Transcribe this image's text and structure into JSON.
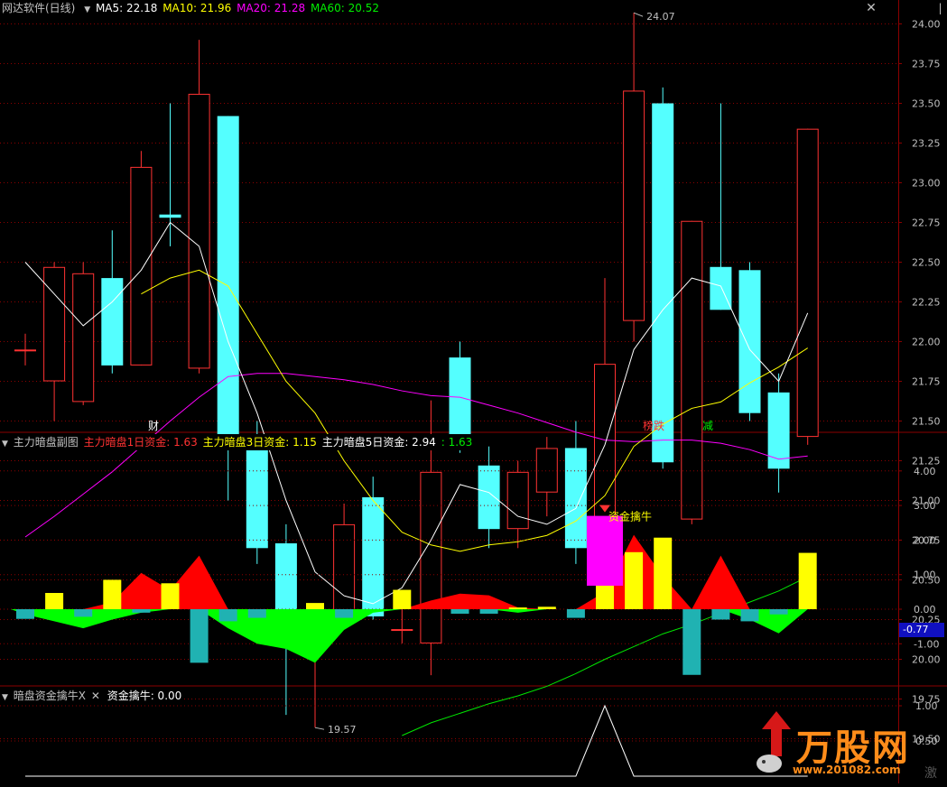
{
  "header": {
    "title": "网达软件(日线)",
    "ma5_label": "MA5: 22.18",
    "ma10_label": "MA10: 21.96",
    "ma20_label": "MA20: 21.28",
    "ma60_label": "MA60: 20.52"
  },
  "colors": {
    "up": "#ff3232",
    "down": "#54ffff",
    "ma5": "#ffffff",
    "ma10": "#ffff00",
    "ma20": "#ff00ff",
    "ma60": "#00e600",
    "grid": "#8b0000",
    "axis_text": "#c0c0c0"
  },
  "main_chart": {
    "y_ticks": [
      "24.00",
      "23.75",
      "23.50",
      "23.25",
      "23.00",
      "22.75",
      "22.50",
      "22.25",
      "22.00",
      "21.75",
      "21.50",
      "21.25",
      "21.00",
      "20.75",
      "20.50",
      "20.25",
      "20.00",
      "19.75",
      "19.50"
    ],
    "high_label": "24.07",
    "low_label": "19.57",
    "events": [
      "财",
      "榜跌",
      "减"
    ],
    "candles": [
      {
        "o": 21.95,
        "c": 21.95,
        "h": 22.05,
        "l": 21.85
      },
      {
        "o": 21.75,
        "c": 22.47,
        "h": 22.5,
        "l": 21.5
      },
      {
        "o": 21.62,
        "c": 22.43,
        "h": 22.5,
        "l": 21.6
      },
      {
        "o": 22.4,
        "c": 21.85,
        "h": 22.7,
        "l": 21.8
      },
      {
        "o": 21.85,
        "c": 23.1,
        "h": 23.2,
        "l": 21.85
      },
      {
        "o": 22.8,
        "c": 22.78,
        "h": 23.5,
        "l": 22.6
      },
      {
        "o": 21.83,
        "c": 23.56,
        "h": 23.9,
        "l": 21.8
      },
      {
        "o": 23.42,
        "c": 21.35,
        "h": 23.42,
        "l": 21.0
      },
      {
        "o": 21.35,
        "c": 20.7,
        "h": 21.5,
        "l": 20.6
      },
      {
        "o": 20.73,
        "c": 20.25,
        "h": 20.85,
        "l": 19.65
      },
      {
        "o": 20.22,
        "c": 20.3,
        "h": 20.3,
        "l": 19.57
      },
      {
        "o": 20.3,
        "c": 20.85,
        "h": 20.98,
        "l": 20.22
      },
      {
        "o": 21.02,
        "c": 20.27,
        "h": 21.15,
        "l": 20.25
      },
      {
        "o": 20.19,
        "c": 20.19,
        "h": 20.38,
        "l": 20.1
      },
      {
        "o": 20.1,
        "c": 21.18,
        "h": 21.63,
        "l": 19.9
      },
      {
        "o": 21.9,
        "c": 21.33,
        "h": 22.0,
        "l": 21.3
      },
      {
        "o": 21.22,
        "c": 20.82,
        "h": 21.34,
        "l": 20.7
      },
      {
        "o": 20.82,
        "c": 21.18,
        "h": 21.25,
        "l": 20.7
      },
      {
        "o": 21.05,
        "c": 21.33,
        "h": 21.4,
        "l": 20.9
      },
      {
        "o": 21.33,
        "c": 20.7,
        "h": 21.5,
        "l": 20.6
      },
      {
        "o": 20.78,
        "c": 21.86,
        "h": 22.4,
        "l": 20.68
      },
      {
        "o": 22.13,
        "c": 23.58,
        "h": 24.07,
        "l": 22.0
      },
      {
        "o": 23.5,
        "c": 21.24,
        "h": 23.6,
        "l": 21.2
      },
      {
        "o": 20.88,
        "c": 22.76,
        "h": 22.76,
        "l": 20.85
      },
      {
        "o": 22.47,
        "c": 22.2,
        "h": 23.5,
        "l": 22.2
      },
      {
        "o": 22.45,
        "c": 21.55,
        "h": 22.5,
        "l": 21.5
      },
      {
        "o": 21.68,
        "c": 21.2,
        "h": 21.8,
        "l": 21.05
      },
      {
        "o": 21.4,
        "c": 23.34,
        "h": 23.34,
        "l": 21.35
      }
    ],
    "ma5": [
      22.5,
      22.3,
      22.1,
      22.25,
      22.45,
      22.75,
      22.6,
      22.0,
      21.55,
      21.0,
      20.55,
      20.4,
      20.35,
      20.45,
      20.75,
      21.1,
      21.05,
      20.9,
      20.85,
      20.95,
      21.35,
      21.95,
      22.2,
      22.4,
      22.35,
      21.95,
      21.75,
      22.18
    ],
    "ma10": [
      null,
      null,
      null,
      null,
      22.3,
      22.4,
      22.45,
      22.35,
      22.05,
      21.75,
      21.55,
      21.25,
      21.0,
      20.8,
      20.72,
      20.68,
      20.72,
      20.74,
      20.78,
      20.87,
      21.03,
      21.34,
      21.48,
      21.58,
      21.62,
      21.74,
      21.84,
      21.96
    ],
    "ma20": [
      20.77,
      20.9,
      21.04,
      21.18,
      21.34,
      21.5,
      21.65,
      21.78,
      21.8,
      21.8,
      21.78,
      21.76,
      21.73,
      21.69,
      21.66,
      21.65,
      21.6,
      21.55,
      21.49,
      21.43,
      21.38,
      21.37,
      21.38,
      21.38,
      21.36,
      21.32,
      21.26,
      21.28
    ],
    "ma60": [
      null,
      null,
      null,
      null,
      null,
      null,
      null,
      null,
      null,
      null,
      null,
      null,
      null,
      19.52,
      19.6,
      19.66,
      19.72,
      19.77,
      19.83,
      19.91,
      20.0,
      20.08,
      20.16,
      20.22,
      20.29,
      20.36,
      20.43,
      20.52
    ]
  },
  "sub_chart": {
    "title": "主力暗盘副图",
    "label1": "主力暗盘1日资金: 1.63",
    "label3": "主力暗盘3日资金: 1.15",
    "label5": "主力暗盘5日资金: 2.94",
    "label_extra": ": 1.63",
    "y_ticks": [
      "4.00",
      "3.00",
      "2.00",
      "1.00",
      "0.00",
      "-1.00"
    ],
    "current_value": "-0.77",
    "annotation": "资金擒牛",
    "area5": [
      -0.15,
      -0.35,
      -0.55,
      -0.3,
      -0.1,
      0.0,
      0.0,
      -0.55,
      -1.0,
      -1.15,
      -1.55,
      -0.6,
      -0.1,
      0.0,
      0.0,
      0.0,
      0.0,
      -0.1,
      0.0,
      0.0,
      0.0,
      0.0,
      0.0,
      0.0,
      0.0,
      -0.3,
      -0.7,
      0.0
    ],
    "area_red": [
      0,
      0,
      0,
      0.2,
      1.05,
      0.55,
      1.55,
      0,
      0,
      0,
      0,
      0,
      0,
      0,
      0.25,
      0.45,
      0.4,
      0.05,
      0,
      0,
      0.5,
      2.15,
      0.95,
      0.0,
      1.55,
      0,
      0,
      0
    ],
    "yellow": [
      0,
      0.47,
      0,
      0.85,
      0,
      0.75,
      0,
      0,
      0,
      0,
      0.18,
      0,
      0,
      0.56,
      0,
      0,
      0,
      0.05,
      0.07,
      0,
      0.7,
      1.65,
      2.07,
      0,
      0,
      0,
      0,
      1.63
    ],
    "cyan": [
      -0.28,
      0,
      -0.22,
      0,
      -0.1,
      0,
      -1.55,
      -0.35,
      -0.25,
      0,
      0,
      -0.25,
      0,
      0,
      0,
      -0.13,
      -0.13,
      0,
      0,
      -0.25,
      0,
      0,
      0,
      -1.9,
      -0.3,
      -0.35,
      -0.15,
      0
    ],
    "magenta_bar": {
      "index": 20,
      "top": 2.7,
      "bottom": 0.68
    }
  },
  "third_chart": {
    "title": "暗盘资金擒牛X",
    "label": "资金擒牛: 0.00",
    "y_ticks": [
      "1.00",
      "0.50"
    ],
    "values": [
      0,
      0,
      0,
      0,
      0,
      0,
      0,
      0,
      0,
      0,
      0,
      0,
      0,
      0,
      0,
      0,
      0,
      0,
      0,
      0,
      1.0,
      0,
      0,
      0,
      0,
      0,
      0,
      0
    ]
  },
  "watermark": {
    "text": "万股网",
    "url": "www.201082.com"
  },
  "icons": {
    "collapse": "triangle-down-icon",
    "close": "close-icon",
    "logo": "bull-logo-icon"
  },
  "side_tab": "|",
  "side_label": "激"
}
